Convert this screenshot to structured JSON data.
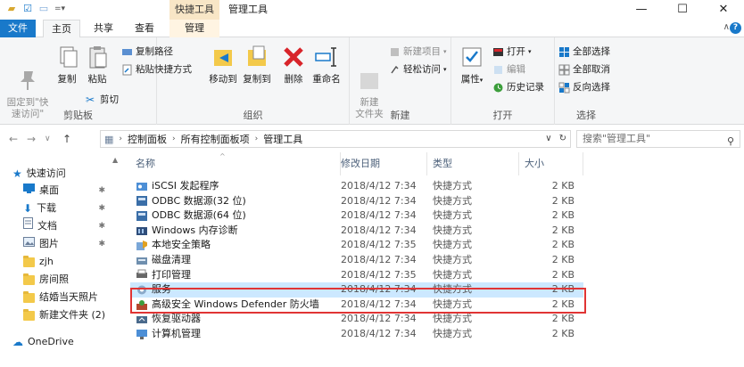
{
  "window": {
    "title": "管理工具",
    "context_tab_header": "快捷工具"
  },
  "controls": {
    "minimize": "—",
    "maximize": "☐",
    "close": "✕"
  },
  "tabs": [
    {
      "label": "文件"
    },
    {
      "label": "主页"
    },
    {
      "label": "共享"
    },
    {
      "label": "查看"
    },
    {
      "label": "管理"
    }
  ],
  "ribbon": {
    "clipboard": {
      "label": "剪贴板",
      "pin": "固定到\"快\n速访问\"",
      "copy": "复制",
      "paste": "粘贴",
      "copy_path": "复制路径",
      "paste_shortcut": "粘贴快捷方式",
      "cut": "剪切"
    },
    "organize": {
      "label": "组织",
      "move_to": "移动到",
      "copy_to": "复制到",
      "delete": "删除",
      "rename": "重命名"
    },
    "new": {
      "label": "新建",
      "new_folder": "新建\n文件夹",
      "new_item": "新建项目",
      "easy_access": "轻松访问"
    },
    "open": {
      "label": "打开",
      "properties": "属性",
      "open": "打开",
      "edit": "编辑",
      "history": "历史记录"
    },
    "select": {
      "label": "选择",
      "select_all": "全部选择",
      "select_none": "全部取消",
      "invert": "反向选择"
    }
  },
  "address": {
    "crumbs": [
      "控制面板",
      "所有控制面板项",
      "管理工具"
    ],
    "search_placeholder": "搜索\"管理工具\""
  },
  "nav": [
    {
      "label": "快速访问",
      "type": "quick",
      "pinned": false
    },
    {
      "label": "桌面",
      "type": "desktop",
      "pinned": true
    },
    {
      "label": "下载",
      "type": "download",
      "pinned": true
    },
    {
      "label": "文档",
      "type": "docs",
      "pinned": true
    },
    {
      "label": "图片",
      "type": "pics",
      "pinned": true
    },
    {
      "label": "zjh",
      "type": "folder",
      "pinned": false
    },
    {
      "label": "房间照",
      "type": "folder",
      "pinned": false
    },
    {
      "label": "结婚当天照片",
      "type": "folder",
      "pinned": false
    },
    {
      "label": "新建文件夹 (2)",
      "type": "folder",
      "pinned": false
    },
    {
      "label": "OneDrive",
      "type": "onedrive",
      "pinned": false
    }
  ],
  "columns": {
    "name": "名称",
    "date": "修改日期",
    "type": "类型",
    "size": "大小"
  },
  "files": [
    {
      "name": "iSCSI 发起程序",
      "date": "2018/4/12 7:34",
      "type": "快捷方式",
      "size": "2 KB",
      "icon": "iscsi"
    },
    {
      "name": "ODBC 数据源(32 位)",
      "date": "2018/4/12 7:34",
      "type": "快捷方式",
      "size": "2 KB",
      "icon": "odbc"
    },
    {
      "name": "ODBC 数据源(64 位)",
      "date": "2018/4/12 7:34",
      "type": "快捷方式",
      "size": "2 KB",
      "icon": "odbc"
    },
    {
      "name": "Windows 内存诊断",
      "date": "2018/4/12 7:34",
      "type": "快捷方式",
      "size": "2 KB",
      "icon": "memory"
    },
    {
      "name": "本地安全策略",
      "date": "2018/4/12 7:35",
      "type": "快捷方式",
      "size": "2 KB",
      "icon": "security"
    },
    {
      "name": "磁盘清理",
      "date": "2018/4/12 7:34",
      "type": "快捷方式",
      "size": "2 KB",
      "icon": "disk"
    },
    {
      "name": "打印管理",
      "date": "2018/4/12 7:35",
      "type": "快捷方式",
      "size": "2 KB",
      "icon": "print"
    },
    {
      "name": "服务",
      "date": "2018/4/12 7:34",
      "type": "快捷方式",
      "size": "2 KB",
      "icon": "services",
      "selected": true
    },
    {
      "name": "高级安全 Windows Defender 防火墙",
      "date": "2018/4/12 7:34",
      "type": "快捷方式",
      "size": "2 KB",
      "icon": "firewall"
    },
    {
      "name": "恢复驱动器",
      "date": "2018/4/12 7:34",
      "type": "快捷方式",
      "size": "2 KB",
      "icon": "recovery"
    },
    {
      "name": "计算机管理",
      "date": "2018/4/12 7:34",
      "type": "快捷方式",
      "size": "2 KB",
      "icon": "computer"
    }
  ]
}
